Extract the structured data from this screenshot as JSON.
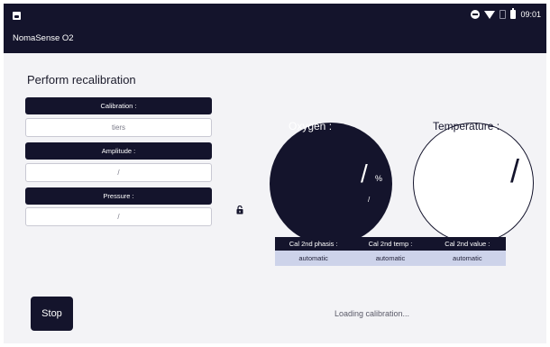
{
  "status_bar": {
    "time": "09:01"
  },
  "app": {
    "title": "NomaSense O2"
  },
  "page": {
    "title": "Perform recalibration"
  },
  "fields": [
    {
      "label": "Calibration :",
      "value": "tiers"
    },
    {
      "label": "Amplitude :",
      "value": "/"
    },
    {
      "label": "Pressure :",
      "value": "/"
    }
  ],
  "oxygen": {
    "label": "Oxygen :",
    "value": "/",
    "unit": "%",
    "mark": "/"
  },
  "temperature": {
    "label": "Temperature :",
    "value": "/"
  },
  "cal_table": {
    "headers": [
      "Cal 2nd phasis :",
      "Cal 2nd temp :",
      "Cal 2nd value :"
    ],
    "values": [
      "automatic",
      "automatic",
      "automatic"
    ]
  },
  "actions": {
    "stop_label": "Stop"
  },
  "status": {
    "loading_text": "Loading calibration..."
  },
  "icons": {
    "lock": "unlocked-padlock-icon"
  },
  "colors": {
    "primary": "#14142c",
    "table_row": "#cdd3ea",
    "background": "#f3f3f6"
  }
}
